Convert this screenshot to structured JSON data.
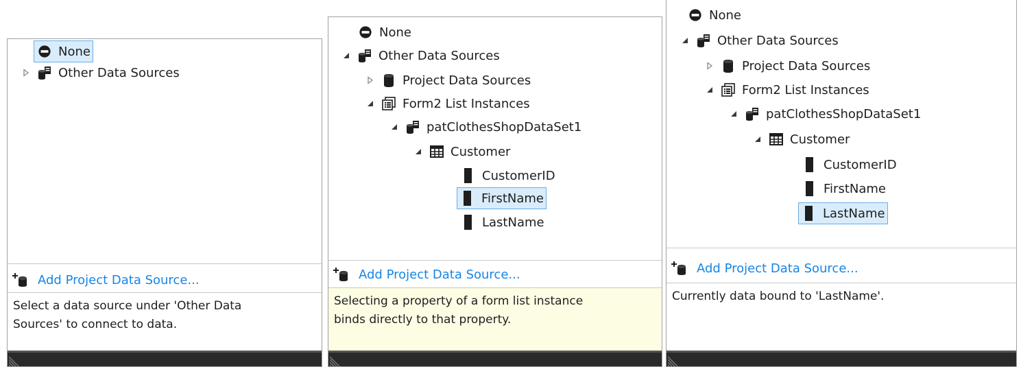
{
  "panels": [
    {
      "tree": {
        "none": "None",
        "other": "Other Data Sources"
      },
      "add_link": "Add Project Data Source...",
      "description_line1": "Select a data source under 'Other Data",
      "description_line2": "Sources' to connect to data."
    },
    {
      "tree": {
        "none": "None",
        "other": "Other Data Sources",
        "project": "Project Data Sources",
        "form2": "Form2 List Instances",
        "dataset": "patClothesShopDataSet1",
        "customer": "Customer",
        "customer_id": "CustomerID",
        "first_name": "FirstName",
        "last_name": "LastName"
      },
      "add_link": "Add Project Data Source...",
      "description_line1": "Selecting a property of a form list instance",
      "description_line2": "binds directly to that property."
    },
    {
      "tree": {
        "none": "None",
        "other": "Other Data Sources",
        "project": "Project Data Sources",
        "form2": "Form2 List Instances",
        "dataset": "patClothesShopDataSet1",
        "customer": "Customer",
        "customer_id": "CustomerID",
        "first_name": "FirstName",
        "last_name": "LastName"
      },
      "add_link": "Add Project Data Source...",
      "description_line1": "Currently data bound to 'LastName'."
    }
  ],
  "colors": {
    "link": "#1585e6",
    "selection_fill": "#d9ecfb",
    "selection_border": "#6aaee6",
    "hint_background": "#fdfde4",
    "grip": "#2a2a2a"
  },
  "icons": {
    "none": "no-entry-icon",
    "sources": "data-sources-icon",
    "database": "database-icon",
    "form_list": "form-list-icon",
    "table": "table-icon",
    "field": "field-icon",
    "add_source": "add-data-source-icon"
  }
}
